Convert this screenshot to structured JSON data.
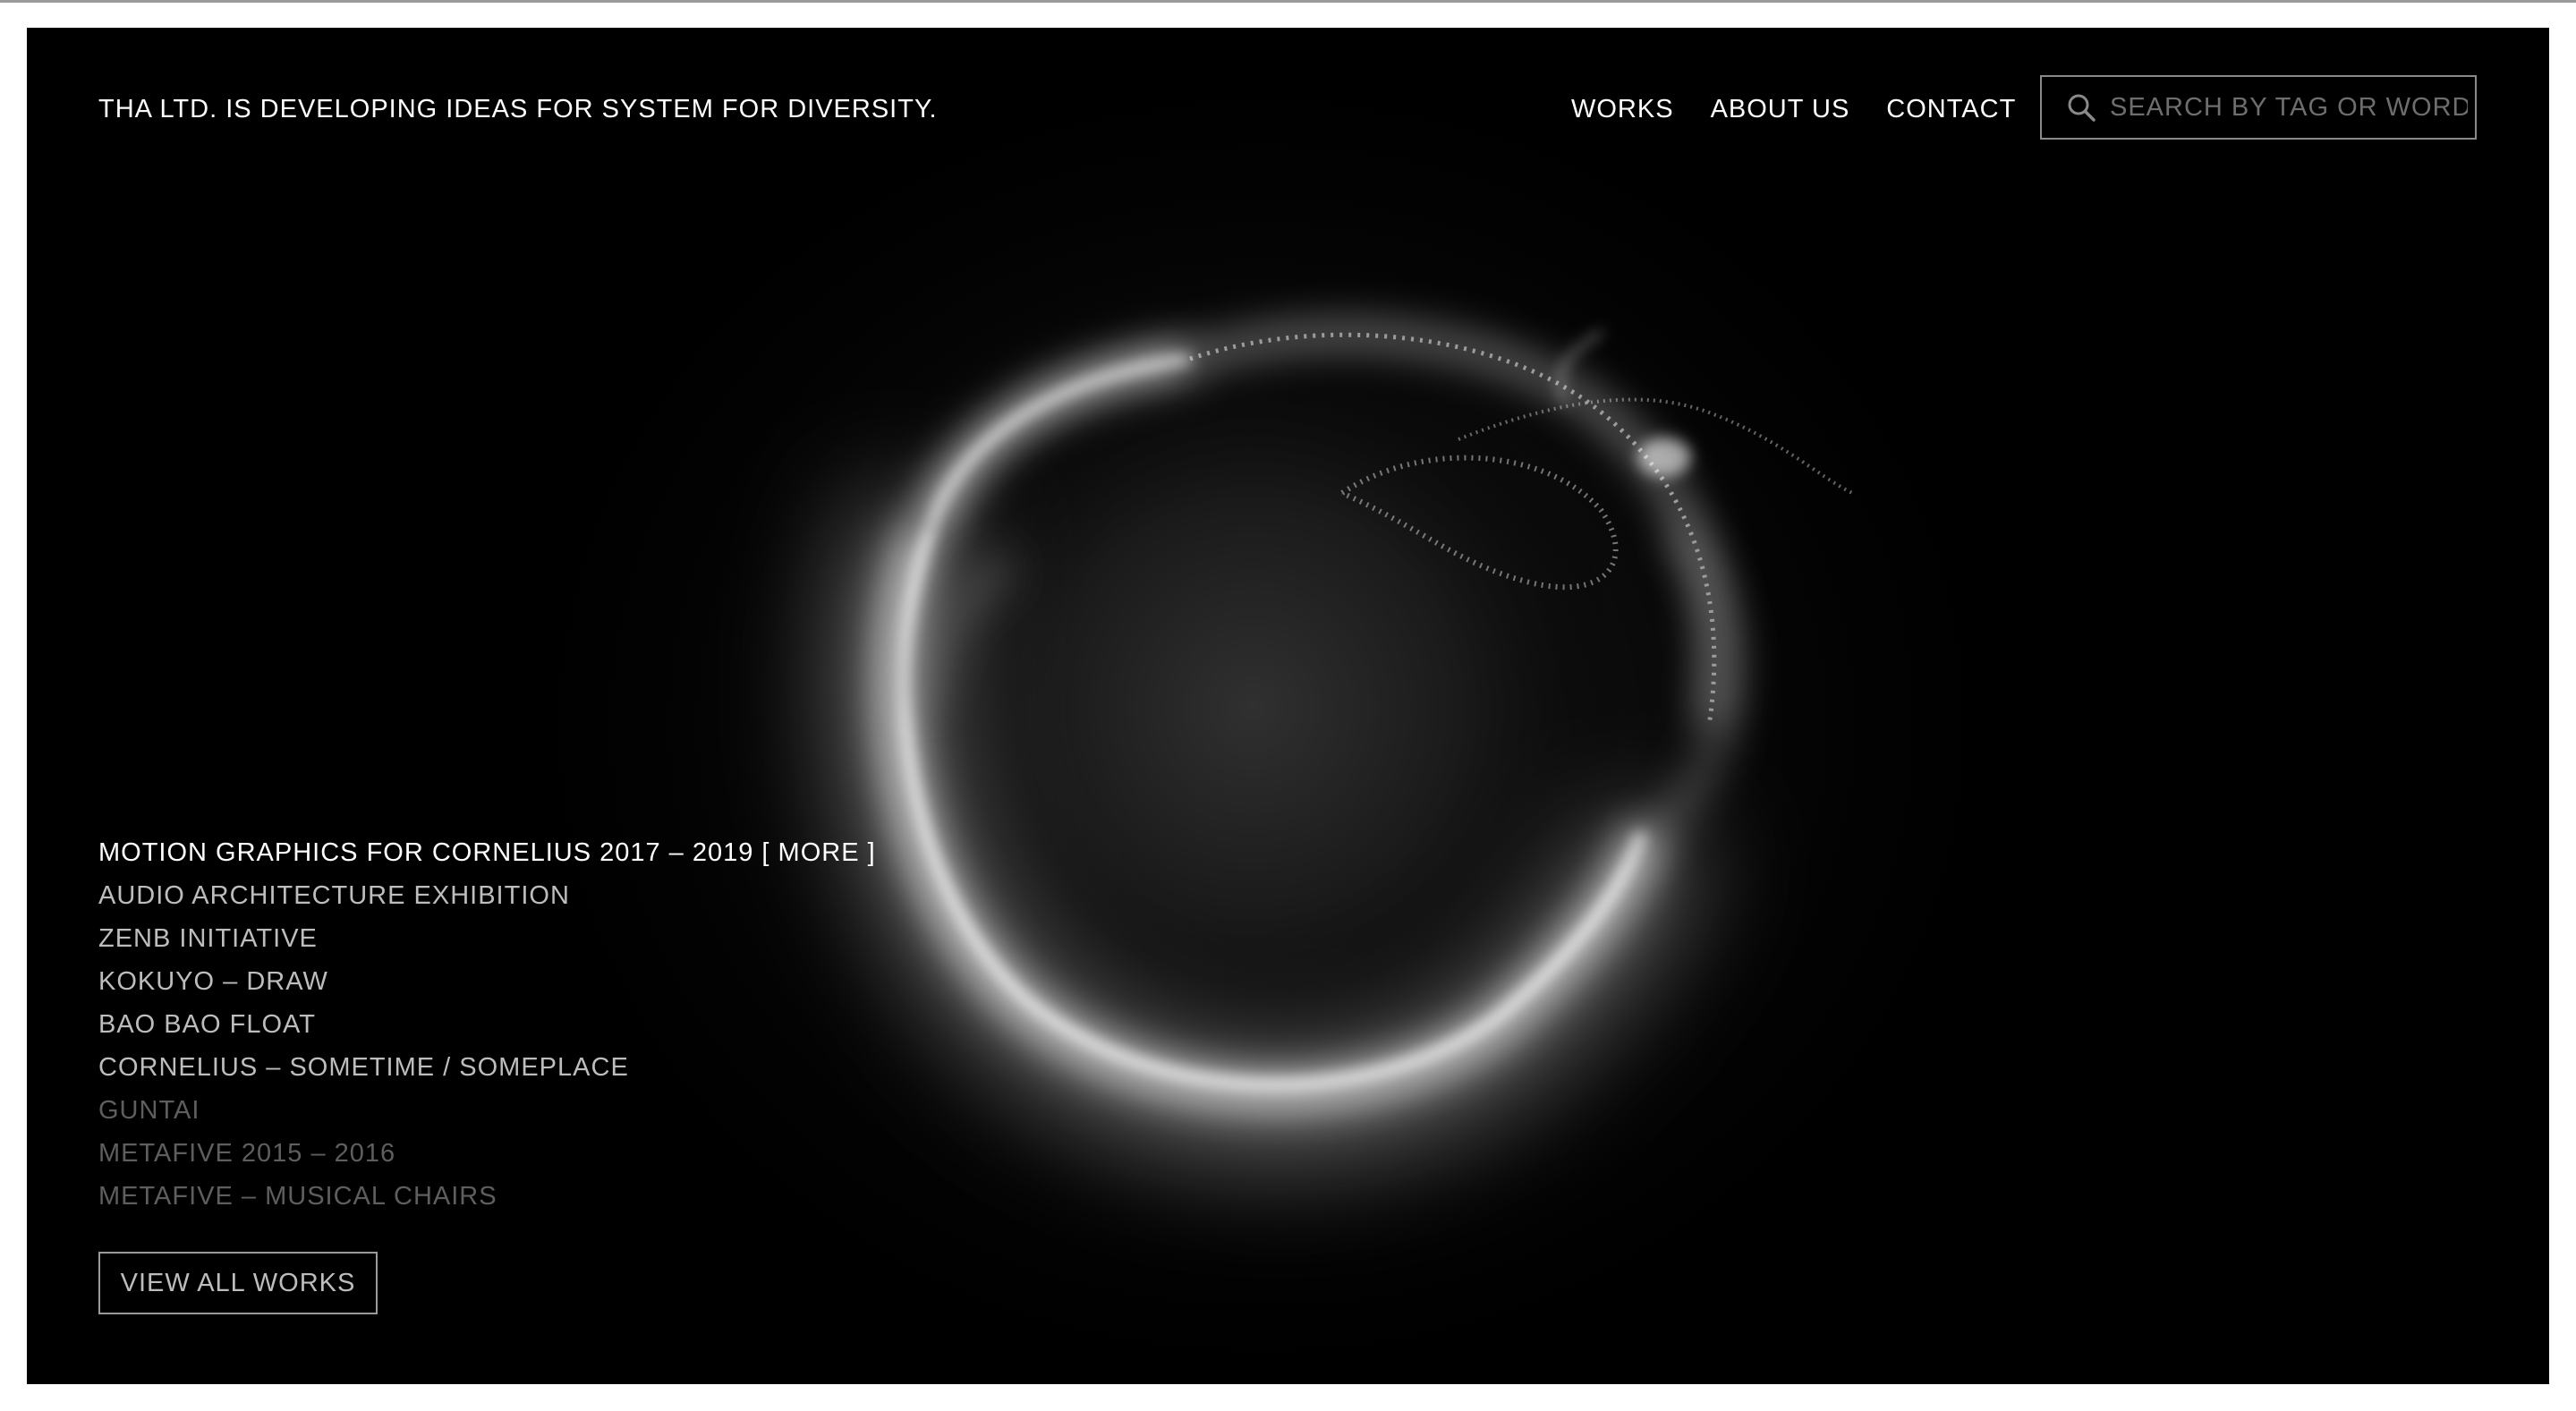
{
  "header": {
    "tagline": "THA LTD. IS DEVELOPING IDEAS FOR SYSTEM FOR DIVERSITY.",
    "nav": [
      {
        "label": "WORKS"
      },
      {
        "label": "ABOUT US"
      },
      {
        "label": "CONTACT"
      }
    ],
    "search": {
      "placeholder": "SEARCH BY TAG OR WORD",
      "value": "",
      "icon": "search-icon"
    }
  },
  "works": {
    "items": [
      {
        "label": "MOTION GRAPHICS FOR CORNELIUS 2017 – 2019 [ MORE ]",
        "state": "active"
      },
      {
        "label": "AUDIO ARCHITECTURE EXHIBITION",
        "state": "normal"
      },
      {
        "label": "ZENB INITIATIVE",
        "state": "normal"
      },
      {
        "label": "KOKUYO – DRAW",
        "state": "normal"
      },
      {
        "label": "BAO BAO FLOAT",
        "state": "normal"
      },
      {
        "label": "CORNELIUS – SOMETIME / SOMEPLACE",
        "state": "normal"
      },
      {
        "label": "GUNTAI",
        "state": "faded"
      },
      {
        "label": "METAFIVE 2015 – 2016",
        "state": "faded"
      },
      {
        "label": "METAFIVE – MUSICAL CHAIRS",
        "state": "faded"
      }
    ],
    "view_all_label": "VIEW ALL WORKS"
  },
  "colors": {
    "background": "#000000",
    "text_primary": "#ffffff",
    "text_secondary": "#bdbdbd",
    "text_faded": "#5e5e5e",
    "border": "#8a8a8a"
  }
}
